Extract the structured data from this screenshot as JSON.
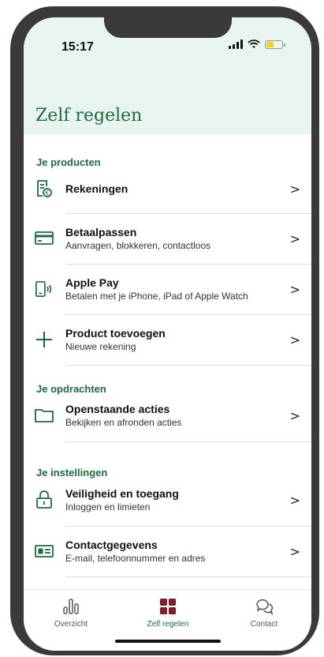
{
  "status_bar": {
    "time": "15:17"
  },
  "header": {
    "title": "Zelf regelen"
  },
  "sections": [
    {
      "title": "Je producten",
      "items": [
        {
          "icon": "account-statement-icon",
          "label": "Rekeningen",
          "sub": ""
        },
        {
          "icon": "card-icon",
          "label": "Betaalpassen",
          "sub": "Aanvragen, blokkeren, contactloos"
        },
        {
          "icon": "phone-contactless-icon",
          "label": "Apple Pay",
          "sub": "Betalen met je iPhone, iPad of Apple Watch"
        },
        {
          "icon": "plus-icon",
          "label": "Product toevoegen",
          "sub": "Nieuwe rekening"
        }
      ]
    },
    {
      "title": "Je opdrachten",
      "items": [
        {
          "icon": "folder-icon",
          "label": "Openstaande acties",
          "sub": "Bekijken en afronden acties"
        }
      ]
    },
    {
      "title": "Je instellingen",
      "items": [
        {
          "icon": "lock-icon",
          "label": "Veiligheid en toegang",
          "sub": "Inloggen en limieten"
        },
        {
          "icon": "contact-card-icon",
          "label": "Contactgegevens",
          "sub": "E-mail, telefoonnummer en adres"
        }
      ]
    }
  ],
  "chevron": ">",
  "tabbar": {
    "tabs": [
      {
        "icon": "overview-chart-icon",
        "label": "Overzicht",
        "active": false
      },
      {
        "icon": "grid-icon",
        "label": "Zelf regelen",
        "active": true
      },
      {
        "icon": "chat-icon",
        "label": "Contact",
        "active": false
      }
    ]
  },
  "colors": {
    "accent": "#1e6b3e",
    "header_bg": "#e7f4ef",
    "active_tab_icon": "#7a1f2b",
    "battery": "#f2d022"
  }
}
